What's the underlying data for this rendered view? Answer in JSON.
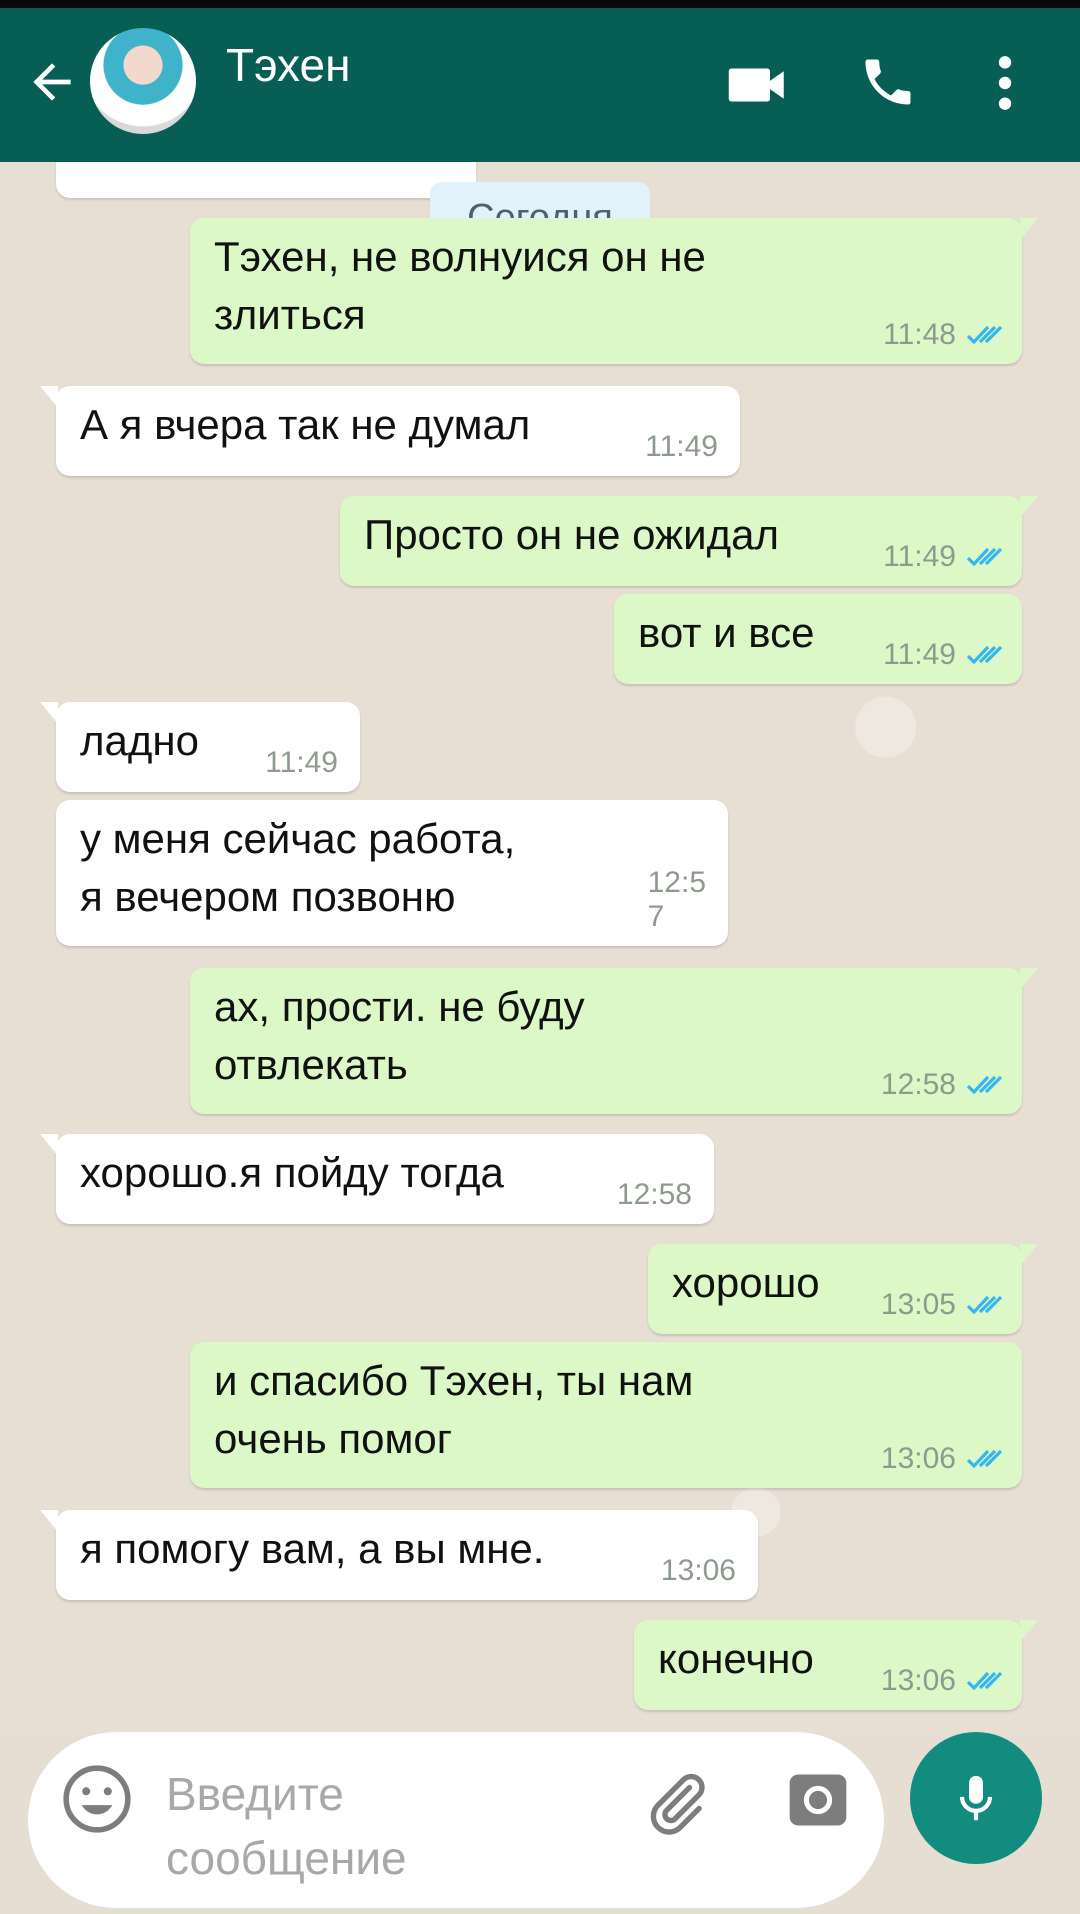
{
  "header": {
    "title": "Тэхен"
  },
  "chat": {
    "date_label": "Сегодня",
    "messages": [
      {
        "dir": "out",
        "text": "Тэхен, не волнуися он не\nзлиться",
        "time": "11:48"
      },
      {
        "dir": "in",
        "text": "А я вчера так не думал",
        "time": "11:49"
      },
      {
        "dir": "out",
        "text": "Просто он не ожидал",
        "time": "11:49"
      },
      {
        "dir": "out",
        "text": "вот и все",
        "time": "11:49"
      },
      {
        "dir": "in",
        "text": "ладно",
        "time": "11:49"
      },
      {
        "dir": "in",
        "text": "у меня сейчас работа,\nя вечером позвоню",
        "time": "12:5\n7"
      },
      {
        "dir": "out",
        "text": "ах, прости. не буду\nотвлекать",
        "time": "12:58"
      },
      {
        "dir": "in",
        "text": "хорошо.я пойду тогда",
        "time": "12:58"
      },
      {
        "dir": "out",
        "text": "хорошо",
        "time": "13:05"
      },
      {
        "dir": "out",
        "text": "и спасибо Тэхен, ты нам\nочень помог",
        "time": "13:06"
      },
      {
        "dir": "in",
        "text": "я помогу вам, а вы мне.",
        "time": "13:06"
      },
      {
        "dir": "out",
        "text": "конечно",
        "time": "13:06"
      }
    ]
  },
  "composer": {
    "placeholder": "Введите\nсообщение"
  },
  "icons": {
    "back": "arrow-left-icon",
    "video": "video-camera-icon",
    "call": "phone-icon",
    "menu": "more-vertical-icon",
    "emoji": "emoji-icon",
    "attach": "paperclip-icon",
    "camera": "camera-icon",
    "mic": "microphone-icon"
  },
  "colors": {
    "header": "#075e54",
    "outgoing_bubble": "#dcf8c6",
    "incoming_bubble": "#ffffff",
    "read_ticks": "#34b7f1",
    "mic_button": "#128c7e"
  }
}
